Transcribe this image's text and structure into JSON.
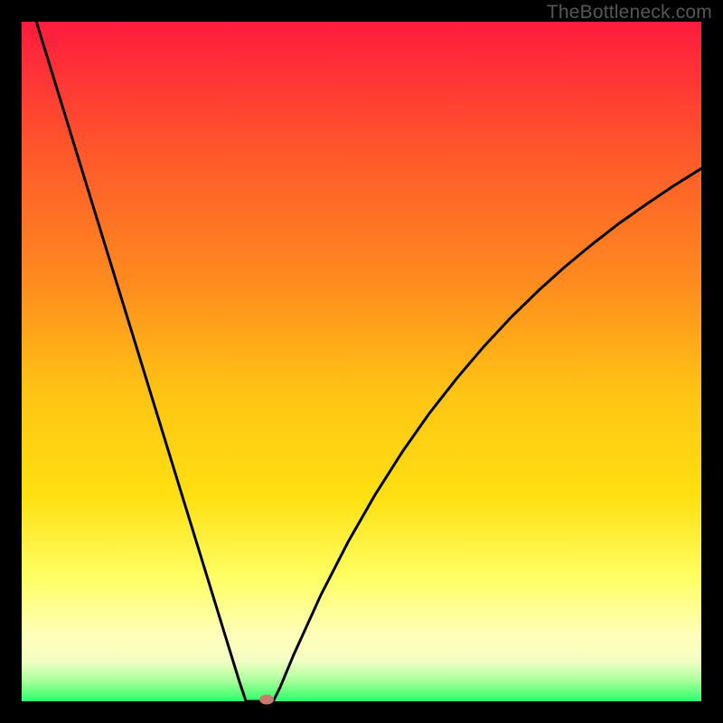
{
  "watermark": "TheBottleneck.com",
  "colors": {
    "top": "#ff1b3e",
    "mid_upper": "#ff8a1f",
    "mid": "#ffe012",
    "mid_lower": "#ffff66",
    "pale": "#ffffb8",
    "green": "#2bff6a",
    "curve": "#000000",
    "marker": "#c97a6e",
    "frame": "#000000"
  },
  "chart_data": {
    "type": "line",
    "title": "",
    "xlabel": "",
    "ylabel": "",
    "xlim": [
      0,
      100
    ],
    "ylim": [
      0,
      100
    ],
    "x": [
      0,
      2,
      4,
      6,
      8,
      10,
      12,
      14,
      16,
      18,
      20,
      22,
      24,
      26,
      28,
      30,
      32,
      33,
      34,
      36,
      37,
      38,
      40,
      44,
      48,
      52,
      56,
      60,
      64,
      68,
      72,
      76,
      80,
      84,
      88,
      92,
      96,
      100
    ],
    "values": [
      107,
      100.5,
      94,
      87.5,
      81,
      74.5,
      68,
      61.5,
      55,
      48.5,
      42,
      35.5,
      29,
      22.5,
      16,
      9.5,
      3,
      0,
      0,
      0,
      0,
      2,
      6.8,
      15.6,
      23.4,
      30.4,
      36.7,
      42.4,
      47.5,
      52.2,
      56.5,
      60.4,
      64,
      67.3,
      70.4,
      73.2,
      75.9,
      78.4
    ],
    "minimum_marker": {
      "x": 36,
      "y": 0
    },
    "notes": "Axes are unlabeled in the source image; x and y are normalized 0-100 to the plot area. The curve is a V-shape: a steep linear descent from top-left to a minimum near x≈34-37, then a concave-rising right branch."
  },
  "layout": {
    "outer_size": 800,
    "plot_offset": 24,
    "plot_size": 752
  }
}
